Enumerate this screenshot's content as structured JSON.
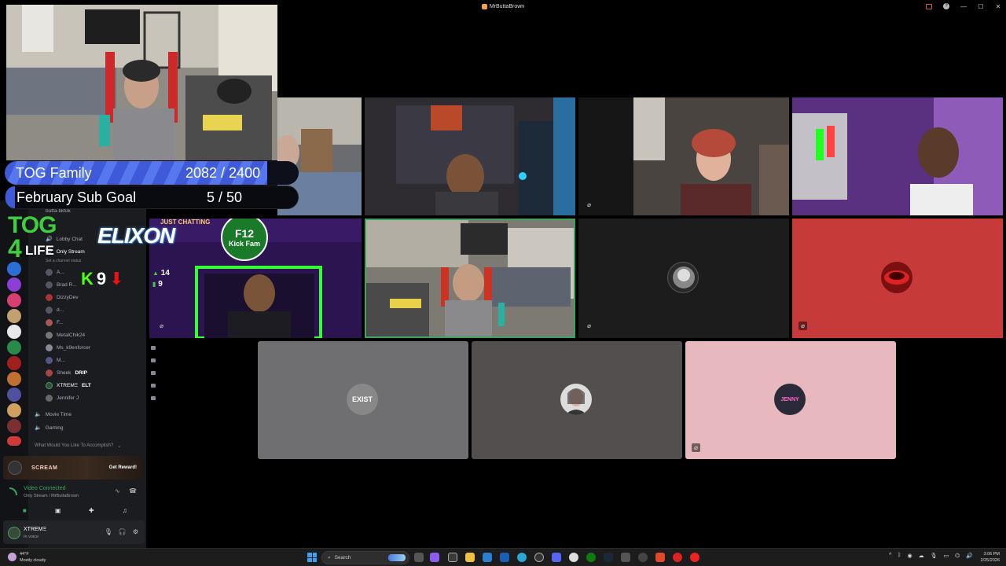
{
  "window": {
    "title": "MrButtaBrown",
    "controls": [
      "minimize",
      "maximize",
      "close"
    ]
  },
  "goals": [
    {
      "label": "TOG Family",
      "value": "2082 / 2400",
      "progress": 0.8675
    },
    {
      "label": "February Sub Goal",
      "value": "5 / 50",
      "progress": 0.1
    }
  ],
  "overlay": {
    "logo_top": "TOG",
    "logo_num": "4",
    "logo_word": "LIFE",
    "elixon": "ELIXON",
    "kick_count": "9",
    "stat_top": "14",
    "stat_bottom": "9",
    "just_chatting": "JUST CHATTING",
    "kick_fam_top": "F12",
    "kick_fam_bottom": "Kick Fam"
  },
  "sidebar": {
    "server_header": "butta-tiktok",
    "channels": [
      {
        "label": "Lobby Chat"
      },
      {
        "label": "Only Stream",
        "sub": "Set a channel status"
      }
    ],
    "voice_members": [
      {
        "name": "A..."
      },
      {
        "name": "Brad R..."
      },
      {
        "name": "DizzyDev"
      },
      {
        "name": "d..."
      },
      {
        "name": "F..."
      },
      {
        "name": "MetalChik24"
      },
      {
        "name": "Ms_k9enforcer"
      },
      {
        "name": "M..."
      },
      {
        "name": "Sheek",
        "badge": "DRIP"
      },
      {
        "name": "XTREMΞ",
        "badge": "ELT"
      },
      {
        "name": "Jennifer J"
      }
    ],
    "other_channels": [
      "Movie Time",
      "Gaming"
    ],
    "category": "What Would You Like To Accomplish?",
    "promo": {
      "name": "SCREAM",
      "button": "Get Reward!"
    },
    "voice_status": "Video Connected",
    "voice_channel": "Only Stream / MrButtaBrown",
    "user": {
      "name": "XTREMΞ",
      "status": "In voice"
    }
  },
  "tiles": {
    "row3": [
      {
        "initials": "EXIST",
        "bg": "#6f6f72"
      },
      {
        "initials": "",
        "bg": "#544f4f"
      },
      {
        "initials": "JENNY",
        "bg": "#e7b8bd"
      }
    ]
  },
  "taskbar": {
    "weather_temp": "44°F",
    "weather_desc": "Mostly cloudy",
    "search_placeholder": "Search",
    "time": "3:06 PM",
    "date": "2/25/2026"
  },
  "colors": {
    "goal_bar": "#4a66e0",
    "kick_green": "#53fc18",
    "tog_green": "#3ecf3e",
    "voice_green": "#3ba55d"
  }
}
